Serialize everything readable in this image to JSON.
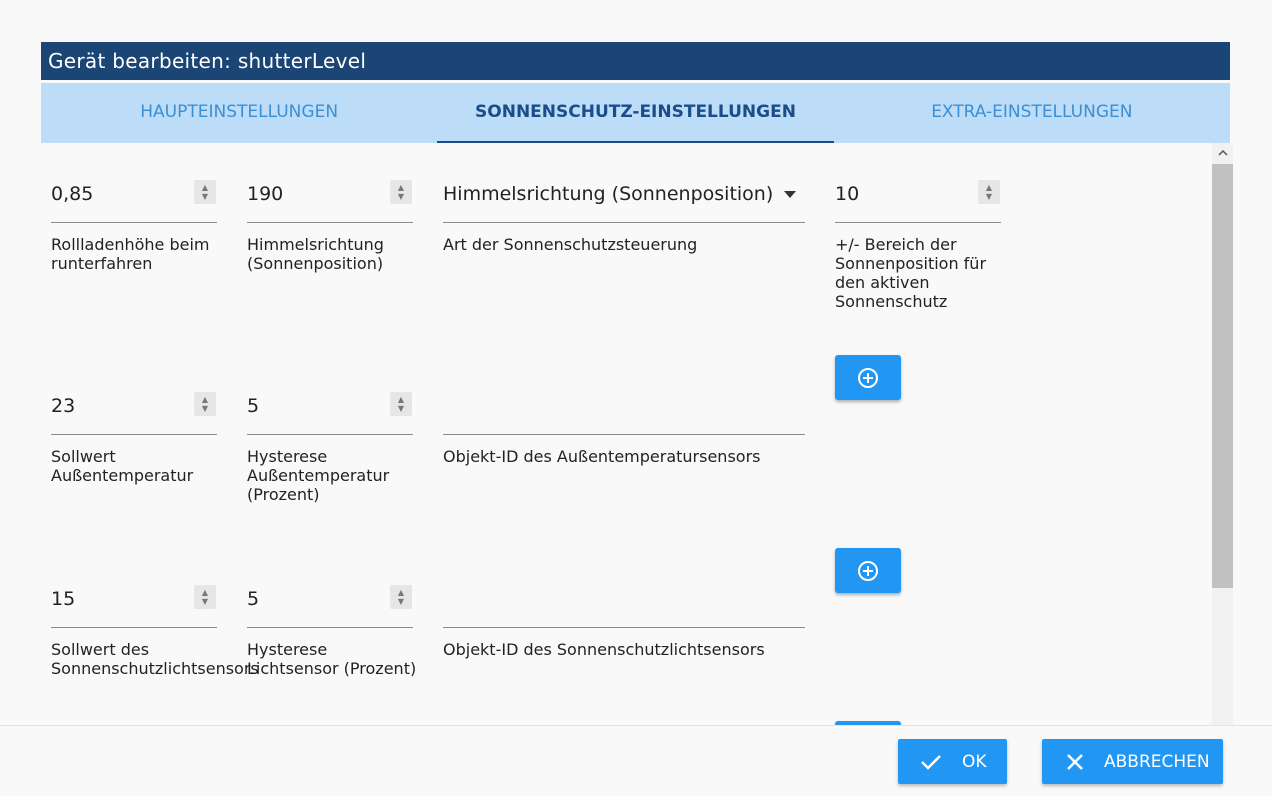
{
  "dialog": {
    "title": "Gerät bearbeiten: shutterLevel"
  },
  "tabs": [
    {
      "label": "HAUPTEINSTELLUNGEN"
    },
    {
      "label": "SONNENSCHUTZ-EINSTELLUNGEN"
    },
    {
      "label": "EXTRA-EINSTELLUNGEN"
    }
  ],
  "fields": {
    "shutter_height": {
      "value": "0,85",
      "label1": "Rollladenhöhe beim",
      "label2": "runterfahren"
    },
    "direction": {
      "value": "190",
      "label1": "Himmelsrichtung",
      "label2": "(Sonnenposition)"
    },
    "control_type": {
      "value": "Himmelsrichtung (Sonnenposition)",
      "label1": "Art der Sonnenschutzsteuerung"
    },
    "range": {
      "value": "10",
      "label1": "+/- Bereich der",
      "label2": "Sonnenposition für",
      "label3": "den aktiven",
      "label4": "Sonnenschutz"
    },
    "temp_setpoint": {
      "value": "23",
      "label1": "Sollwert",
      "label2": "Außentemperatur"
    },
    "temp_hysteresis": {
      "value": "5",
      "label1": "Hysterese",
      "label2": "Außentemperatur",
      "label3": "(Prozent)"
    },
    "temp_sensor": {
      "value": "",
      "label1": "Objekt-ID des Außentemperatursensors"
    },
    "light_setpoint": {
      "value": "15",
      "label1": "Sollwert des",
      "label2": "Sonnenschutzlichtsensors"
    },
    "light_hysteresis": {
      "value": "5",
      "label1": "Hysterese",
      "label2": "Lichtsensor (Prozent)"
    },
    "light_sensor": {
      "value": "",
      "label1": "Objekt-ID des Sonnenschutzlichtsensors"
    }
  },
  "footer": {
    "ok_label": "OK",
    "cancel_label": "ABBRECHEN"
  },
  "colors": {
    "header": "#1a4574",
    "tabbar": "#bcdcf7",
    "accent": "#2196f3",
    "active_tab": "#1a4d8a"
  },
  "icons": {
    "add": "plus-circle-icon",
    "ok": "check-icon",
    "cancel": "close-icon"
  }
}
